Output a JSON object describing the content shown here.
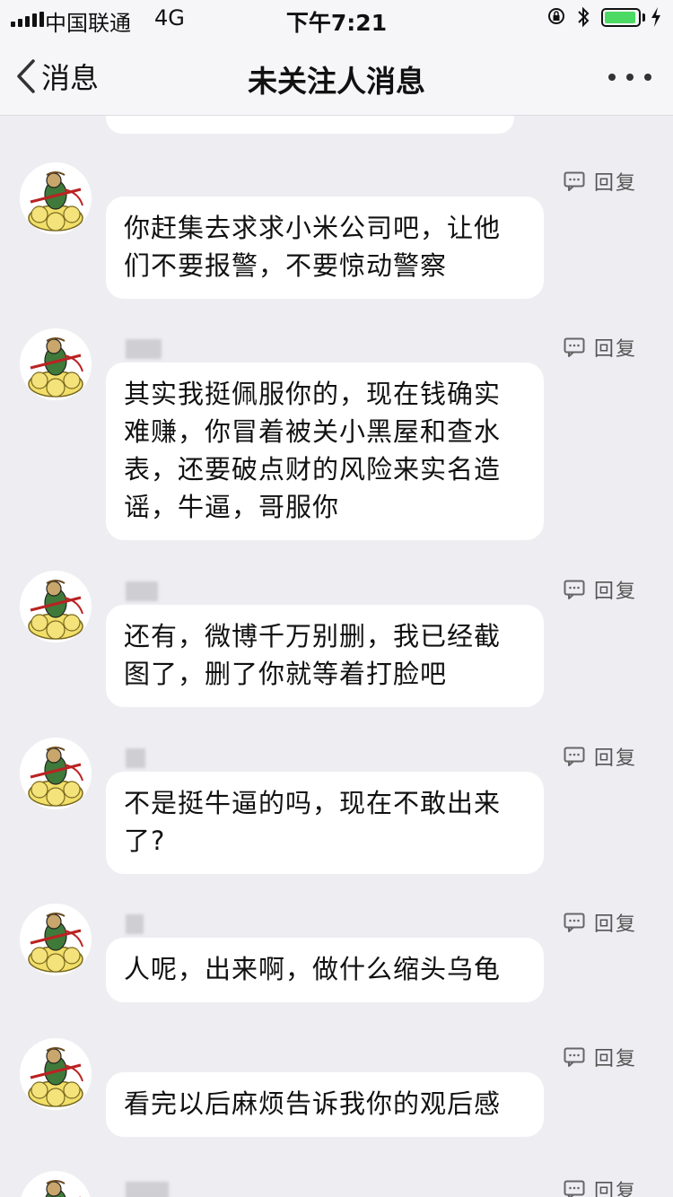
{
  "status_bar": {
    "carrier": "中国联通",
    "network": "4G",
    "time": "下午7:21"
  },
  "nav": {
    "back_label": "消息",
    "title": "未关注人消息"
  },
  "messages": [
    {
      "text": "你赶集去求求小米公司吧，让他们不要报警，不要惊动警察",
      "reply_label": "回复"
    },
    {
      "text": "其实我挺佩服你的，现在钱确实难赚，你冒着被关小黑屋和查水表，还要破点财的风险来实名造谣，牛逼，哥服你",
      "reply_label": "回复"
    },
    {
      "text": "还有，微博千万别删，我已经截图了，删了你就等着打脸吧",
      "reply_label": "回复"
    },
    {
      "text": "不是挺牛逼的吗，现在不敢出来了?",
      "reply_label": "回复"
    },
    {
      "text": "人呢，出来啊，做什么缩头乌龟",
      "reply_label": "回复"
    },
    {
      "text": "看完以后麻烦告诉我你的观后感",
      "reply_label": "回复"
    },
    {
      "reply_label": "回复"
    }
  ],
  "colors": {
    "background": "#eeedf1",
    "bubble": "#ffffff",
    "battery": "#4cd964"
  }
}
